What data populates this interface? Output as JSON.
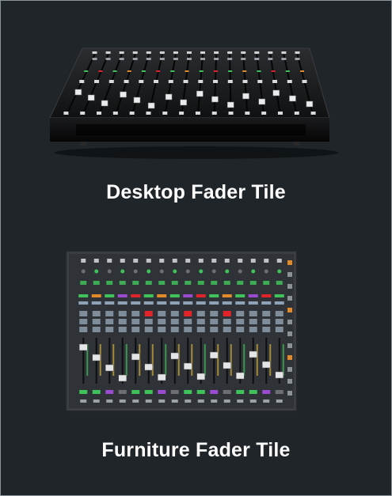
{
  "tiles": [
    {
      "label": "Desktop Fader Tile",
      "image": "desktop-fader-console"
    },
    {
      "label": "Furniture Fader Tile",
      "image": "furniture-fader-console"
    }
  ],
  "colors": {
    "background": "#1f2529",
    "border": "#8e959a",
    "caption": "#ffffff",
    "console_dark": "#141414",
    "panel_grey": "#3a3d42",
    "led_green": "#3fc25a",
    "led_red": "#e0242a",
    "led_purple": "#9a4bd0",
    "led_orange": "#e08a2a"
  }
}
